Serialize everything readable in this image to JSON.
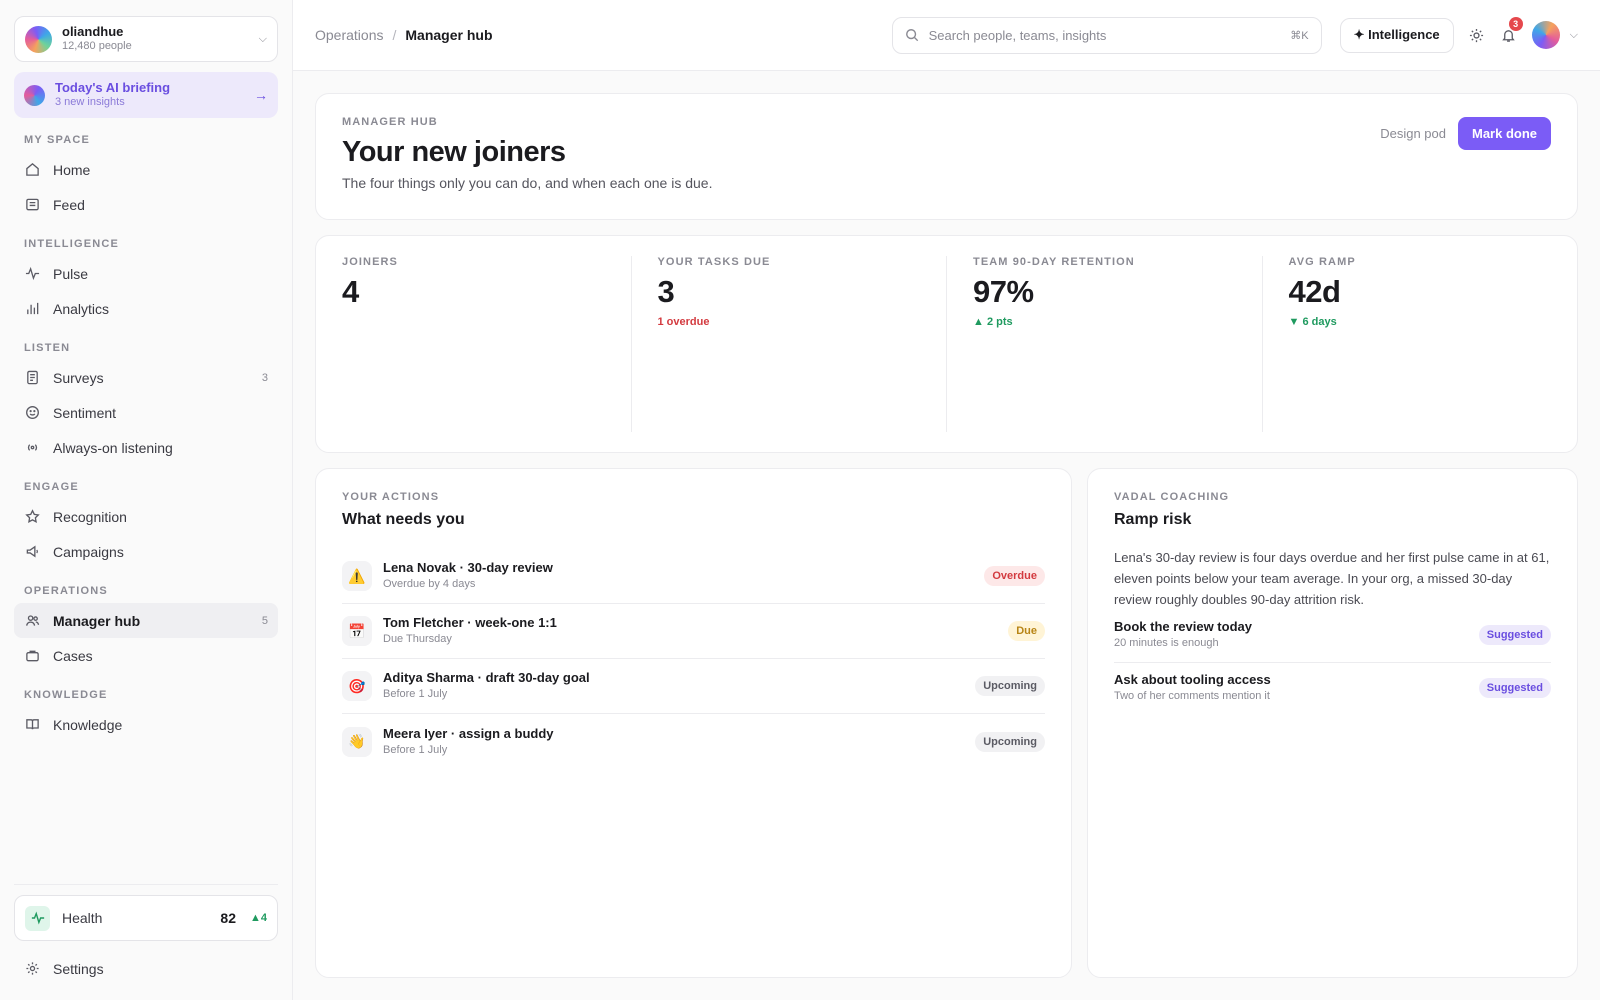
{
  "org": {
    "name": "oliandhue",
    "people": "12,480 people"
  },
  "briefing": {
    "title": "Today's AI briefing",
    "subtitle": "3 new insights"
  },
  "nav": {
    "my_space": {
      "label": "MY SPACE",
      "items": [
        {
          "label": "Home"
        },
        {
          "label": "Feed"
        }
      ]
    },
    "intelligence": {
      "label": "INTELLIGENCE",
      "items": [
        {
          "label": "Pulse"
        },
        {
          "label": "Analytics"
        }
      ]
    },
    "listen": {
      "label": "LISTEN",
      "items": [
        {
          "label": "Surveys",
          "count": "3"
        },
        {
          "label": "Sentiment"
        },
        {
          "label": "Always-on listening"
        }
      ]
    },
    "engage": {
      "label": "ENGAGE",
      "items": [
        {
          "label": "Recognition"
        },
        {
          "label": "Campaigns"
        }
      ]
    },
    "operations": {
      "label": "OPERATIONS",
      "items": [
        {
          "label": "Manager hub",
          "count": "5"
        },
        {
          "label": "Cases"
        }
      ]
    },
    "knowledge": {
      "label": "KNOWLEDGE",
      "items": [
        {
          "label": "Knowledge"
        }
      ]
    }
  },
  "health": {
    "label": "Health",
    "score": "82",
    "delta": "▲4"
  },
  "settings": {
    "label": "Settings"
  },
  "breadcrumb": {
    "parent": "Operations",
    "separator": "/",
    "current": "Manager hub"
  },
  "search": {
    "placeholder": "Search people, teams, insights",
    "shortcut": "⌘K"
  },
  "topbar": {
    "intelligence_label": "✦ Intelligence",
    "notification_count": "3"
  },
  "hero": {
    "eyebrow": "MANAGER HUB",
    "title": "Your new joiners",
    "subtitle": "The four things only you can do, and when each one is due.",
    "pod": "Design pod",
    "action_label": "Mark done"
  },
  "stats": [
    {
      "label": "JOINERS",
      "value": "4",
      "note": ""
    },
    {
      "label": "YOUR TASKS DUE",
      "value": "3",
      "note": "1 overdue"
    },
    {
      "label": "TEAM 90-DAY RETENTION",
      "value": "97%",
      "note": "▲ 2 pts"
    },
    {
      "label": "AVG RAMP",
      "value": "42d",
      "note": "▼ 6 days"
    }
  ],
  "actions": {
    "eyebrow": "YOUR ACTIONS",
    "title": "What needs you",
    "items": [
      {
        "icon": "⚠️",
        "title": "Lena Novak · 30-day review",
        "subtitle": "Overdue by 4 days",
        "status": "Overdue"
      },
      {
        "icon": "📅",
        "title": "Tom Fletcher · week-one 1:1",
        "subtitle": "Due Thursday",
        "status": "Due"
      },
      {
        "icon": "🎯",
        "title": "Aditya Sharma · draft 30-day goal",
        "subtitle": "Before 1 July",
        "status": "Upcoming"
      },
      {
        "icon": "👋",
        "title": "Meera Iyer · assign a buddy",
        "subtitle": "Before 1 July",
        "status": "Upcoming"
      }
    ]
  },
  "coaching": {
    "eyebrow": "VADAL COACHING",
    "title": "Ramp risk",
    "body": "Lena's 30-day review is four days overdue and her first pulse came in at 61, eleven points below your team average. In your org, a missed 30-day review roughly doubles 90-day attrition risk.",
    "items": [
      {
        "title": "Book the review today",
        "subtitle": "20 minutes is enough",
        "status": "Suggested"
      },
      {
        "title": "Ask about tooling access",
        "subtitle": "Two of her comments mention it",
        "status": "Suggested"
      }
    ]
  },
  "colors": {
    "accent": "#7b5cf6",
    "danger": "#d33a3f",
    "success": "#1f9a5f",
    "warning": "#b88516"
  }
}
